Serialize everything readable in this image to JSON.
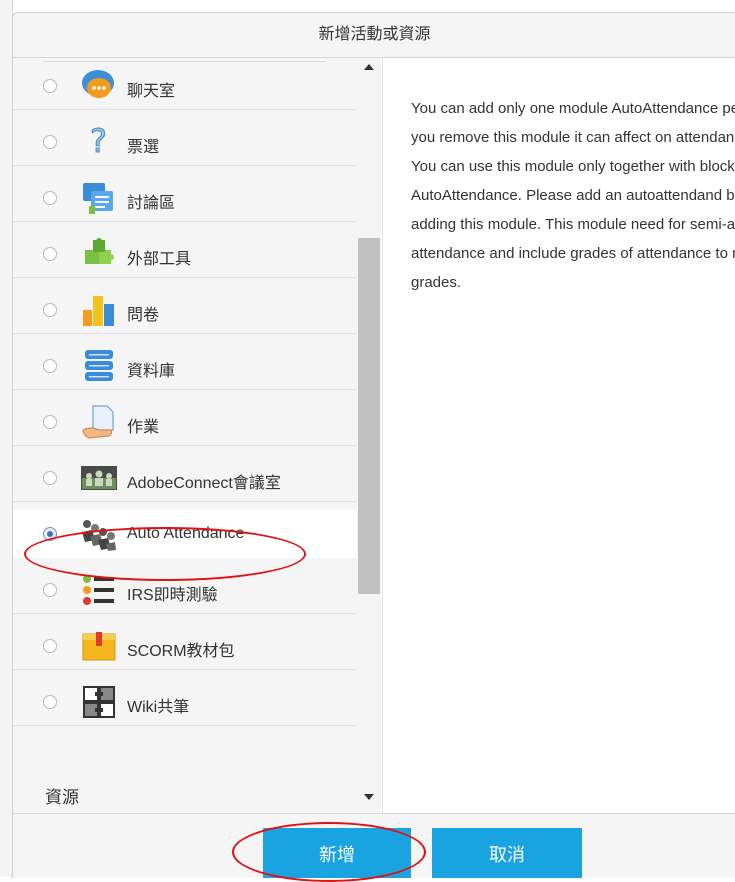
{
  "dialog": {
    "title": "新增活動或資源"
  },
  "activities": [
    {
      "label": "聊天室",
      "icon": "chat-bubble-icon",
      "selected": false
    },
    {
      "label": "票選",
      "icon": "question-mark-icon",
      "selected": false
    },
    {
      "label": "討論區",
      "icon": "forum-icon",
      "selected": false
    },
    {
      "label": "外部工具",
      "icon": "puzzle-icon",
      "selected": false
    },
    {
      "label": "問卷",
      "icon": "bar-chart-icon",
      "selected": false
    },
    {
      "label": "資料庫",
      "icon": "database-icon",
      "selected": false
    },
    {
      "label": "作業",
      "icon": "assignment-hand-icon",
      "selected": false
    },
    {
      "label": "AdobeConnect會議室",
      "icon": "meeting-people-icon",
      "selected": false
    },
    {
      "label": "Auto Attendance",
      "icon": "group-people-icon",
      "selected": true
    },
    {
      "label": "IRS即時測驗",
      "icon": "quiz-list-icon",
      "selected": false
    },
    {
      "label": "SCORM教材包",
      "icon": "package-box-icon",
      "selected": false
    },
    {
      "label": "Wiki共筆",
      "icon": "wiki-puzzle-icon",
      "selected": false
    }
  ],
  "section": {
    "resources_label": "資源"
  },
  "description": {
    "paragraphs": [
      "You can add only one module AutoAttendance per course. If you remove this module it can affect on attendances!",
      "You can use this module only together with block AutoAttendance. Please add an autoattendand block before adding this module. This module need for semi-automatic attendance and include grades of attendance to main course's grades."
    ]
  },
  "footer": {
    "add_label": "新增",
    "cancel_label": "取消"
  },
  "colors": {
    "button": "#1aa3e1",
    "annotation": "#e01212",
    "header_bg": "#f5f5f5"
  }
}
